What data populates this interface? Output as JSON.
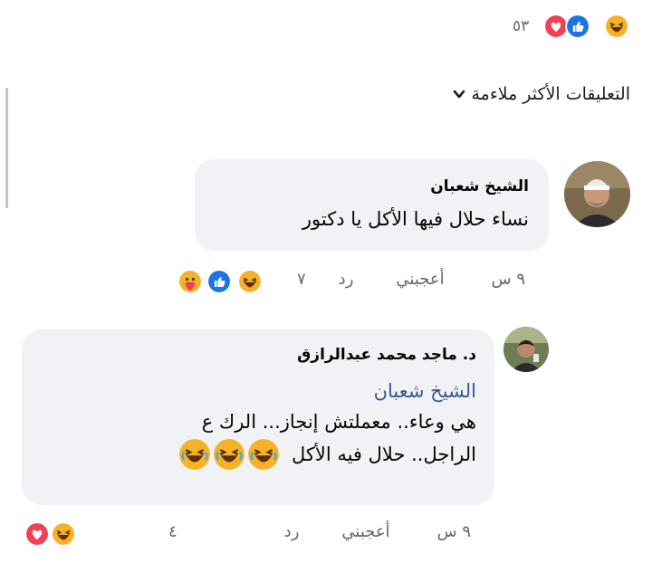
{
  "summary": {
    "count": "٥٣",
    "icons": [
      "laugh-icon",
      "like-icon",
      "love-icon"
    ]
  },
  "sort": {
    "label": "التعليقات الأكثر ملاءمة"
  },
  "comments": [
    {
      "author": "الشيخ شعبان",
      "text": "نساء حلال فيها الأكل يا دكتور",
      "time": "٩ س",
      "like_label": "أعجبني",
      "reply_label": "رد",
      "reactions_count": "٧",
      "reaction_icons": [
        "care-icon",
        "like-icon",
        "laugh-icon"
      ]
    },
    {
      "author": "د. ماجد محمد عبدالرازق",
      "mention": "الشيخ شعبان",
      "line1": "هي وعاء.. معملتش إنجاز... الرك ع",
      "line2": "الراجل.. حلال فيه الأكل",
      "inline_emoji": [
        "laugh-icon",
        "laugh-icon",
        "laugh-icon"
      ],
      "time": "٩ س",
      "like_label": "أعجبني",
      "reply_label": "رد",
      "reactions_count": "٤",
      "reaction_icons": [
        "laugh-icon",
        "love-icon"
      ]
    }
  ]
}
